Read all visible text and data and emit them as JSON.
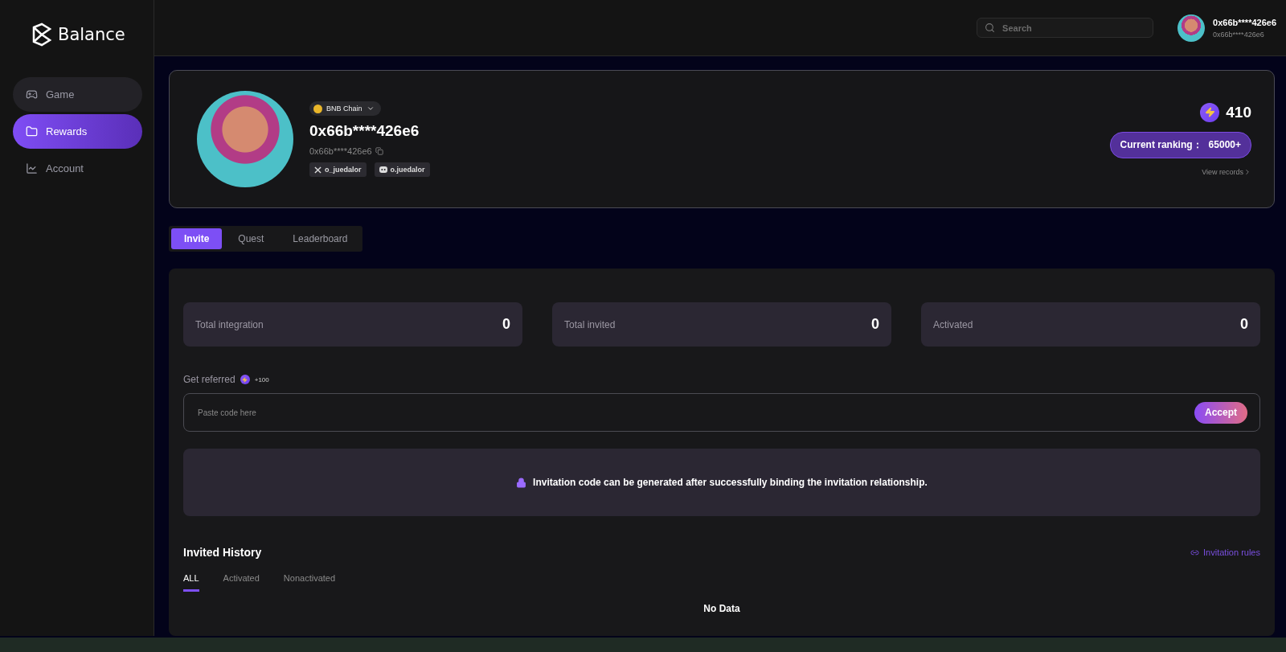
{
  "brand": {
    "name": "Balance"
  },
  "sidebar": {
    "items": [
      {
        "label": "Game",
        "selected": false,
        "kind": "game"
      },
      {
        "label": "Rewards",
        "selected": true,
        "kind": "rewards"
      },
      {
        "label": "Account",
        "selected": false,
        "kind": "account"
      }
    ]
  },
  "header": {
    "search": {
      "placeholder": "Search"
    },
    "user": {
      "name": "0x66b****426e6",
      "address": "0x66b****426e6"
    }
  },
  "profile": {
    "chain": "BNB Chain",
    "address": "0x66b****426e6",
    "short_address": "0x66b****426e6",
    "socials": [
      {
        "kind": "x",
        "handle": "o_juedalor"
      },
      {
        "kind": "discord",
        "handle": "o.juedalor"
      }
    ],
    "points": "410",
    "ranking_label": "Current ranking：",
    "ranking_value": "65000+",
    "view_records": "View records"
  },
  "tabs": [
    {
      "label": "Invite",
      "selected": true
    },
    {
      "label": "Quest",
      "selected": false
    },
    {
      "label": "Leaderboard",
      "selected": false
    }
  ],
  "stats": [
    {
      "label": "Total integration",
      "value": "0"
    },
    {
      "label": "Total invited",
      "value": "0"
    },
    {
      "label": "Activated",
      "value": "0"
    }
  ],
  "referral": {
    "label": "Get referred",
    "bonus": "+100",
    "placeholder": "Paste code here",
    "button": "Accept"
  },
  "notice": "Invitation code can be generated after successfully binding the invitation relationship.",
  "history": {
    "title": "Invited History",
    "rules_link": "Invitation rules",
    "filters": [
      {
        "label": "ALL",
        "selected": true
      },
      {
        "label": "Activated",
        "selected": false
      },
      {
        "label": "Nonactivated",
        "selected": false
      }
    ],
    "empty": "No Data"
  }
}
